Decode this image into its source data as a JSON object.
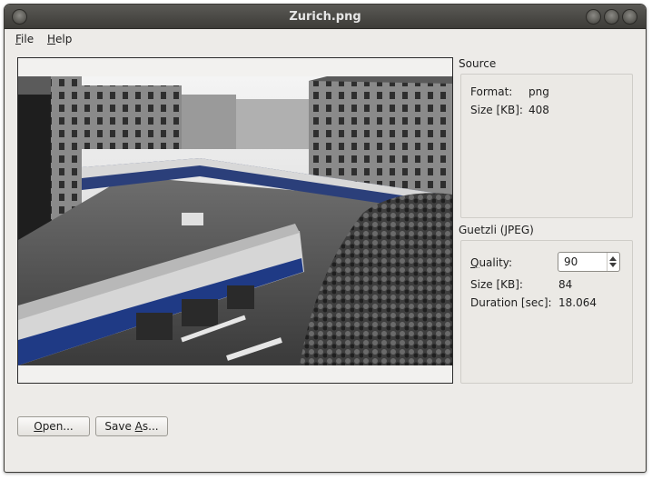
{
  "window": {
    "title": "Zurich.png"
  },
  "menu": [
    {
      "label": "File",
      "accel": "F",
      "rest": "ile"
    },
    {
      "label": "Help",
      "accel": "H",
      "rest": "elp"
    }
  ],
  "source": {
    "title": "Source",
    "format_label": "Format:",
    "format_value": "png",
    "size_label": "Size [KB]:",
    "size_value": "408"
  },
  "guetzli": {
    "title": "Guetzli (JPEG)",
    "quality_label": "Quality:",
    "quality_accel": "Q",
    "quality_rest": "uality:",
    "quality_value": "90",
    "size_label": "Size [KB]:",
    "size_value": "84",
    "duration_label": "Duration [sec]:",
    "duration_value": "18.064"
  },
  "buttons": {
    "open_label": "Open...",
    "open_accel": "O",
    "open_rest": "pen...",
    "save_as_label": "Save As...",
    "save_as_prefix": "Save ",
    "save_as_accel": "A",
    "save_as_rest": "s..."
  }
}
